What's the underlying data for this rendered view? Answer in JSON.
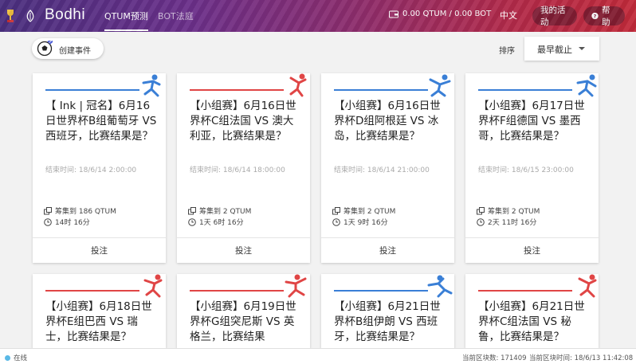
{
  "header": {
    "brand": "Bodhi",
    "tabs": [
      {
        "label": "QTUM预测",
        "active": true
      },
      {
        "label": "BOT法庭",
        "active": false
      }
    ],
    "wallet": "0.00 QTUM / 0.00 BOT",
    "language": "中文",
    "my_activity": "我的活动",
    "help": "帮助"
  },
  "toolbar": {
    "create_event": "创建事件",
    "sort_label": "排序",
    "sort_value": "最早截止"
  },
  "cards": [
    {
      "title": "【 Ink | 冠名】6月16日世界杯B组葡萄牙 VS 西班牙，比赛结果是？",
      "end_time": "结束时间: 18/6/14 2:00:00",
      "raised": "筹集到 186 QTUM",
      "remaining": "14时 16分",
      "action": "投注",
      "accent": "#3a7fd6"
    },
    {
      "title": "【小组赛】6月16日世界杯C组法国 VS 澳大利亚，比赛结果是？",
      "end_time": "结束时间: 18/6/14 18:00:00",
      "raised": "筹集到 2 QTUM",
      "remaining": "1天 6时 16分",
      "action": "投注",
      "accent": "#e04545"
    },
    {
      "title": "【小组赛】6月16日世界杯D组阿根廷 VS 冰岛，比赛结果是？",
      "end_time": "结束时间: 18/6/14 21:00:00",
      "raised": "筹集到 2 QTUM",
      "remaining": "1天 9时 16分",
      "action": "投注",
      "accent": "#3a7fd6"
    },
    {
      "title": "【小组赛】6月17日世界杯F组德国 VS 墨西哥，比赛结果是？",
      "end_time": "结束时间: 18/6/15 23:00:00",
      "raised": "筹集到 2 QTUM",
      "remaining": "2天 11时 16分",
      "action": "投注",
      "accent": "#3a7fd6"
    },
    {
      "title": "【小组赛】6月18日世界杯E组巴西 VS 瑞士，比赛结果是？",
      "accent": "#3a7fd6"
    },
    {
      "title": "【小组赛】6月19日世界杯G组突尼斯 VS 英格兰，比赛结果",
      "accent": "#e04545"
    },
    {
      "title": "【小组赛】6月21日世界杯B组伊朗 VS 西班牙，比赛结果是？",
      "accent": "#3a7fd6"
    },
    {
      "title": "【小组赛】6月21日世界杯C组法国 VS 秘鲁，比赛结果是？",
      "accent": "#e04545"
    }
  ],
  "footer": {
    "status": "在线",
    "block_label": "当前区块数: 171409",
    "block_time": "当前区块时间: 18/6/13 11:42:08"
  }
}
